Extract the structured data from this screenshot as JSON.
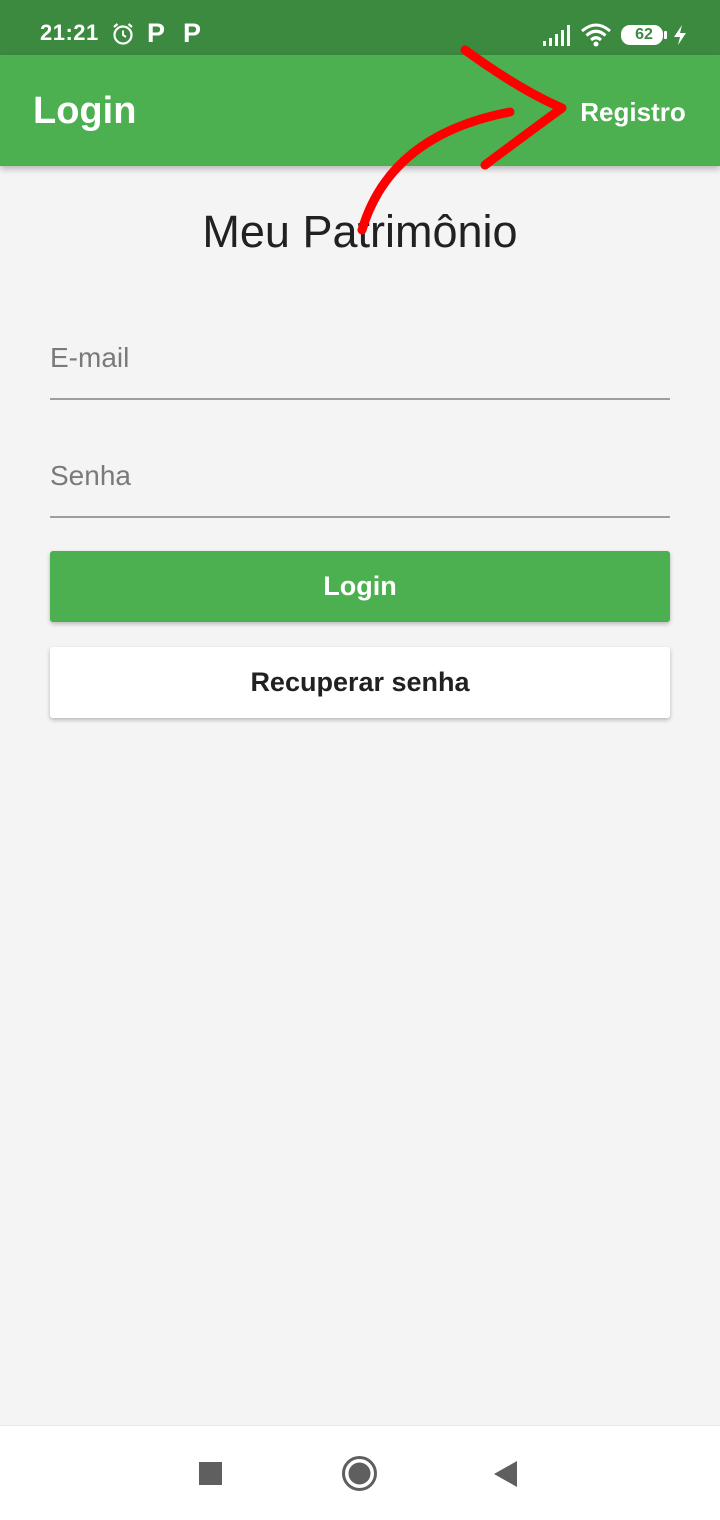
{
  "status_bar": {
    "time": "21:21",
    "battery_level": "62",
    "icons": [
      "alarm-icon",
      "p-icon",
      "p-icon",
      "signal-icon",
      "wifi-icon",
      "battery-icon",
      "bolt-icon"
    ],
    "p_glyph": "P"
  },
  "app_bar": {
    "title": "Login",
    "register_label": "Registro",
    "color": "#4caf50"
  },
  "main": {
    "heading": "Meu Patrimônio",
    "email_placeholder": "E-mail",
    "password_placeholder": "Senha",
    "login_label": "Login",
    "recover_label": "Recuperar senha"
  },
  "annotation": {
    "arrow_color": "#ff0000"
  },
  "nav_bar": {
    "icons": [
      "recents-icon",
      "home-icon",
      "back-icon"
    ]
  }
}
